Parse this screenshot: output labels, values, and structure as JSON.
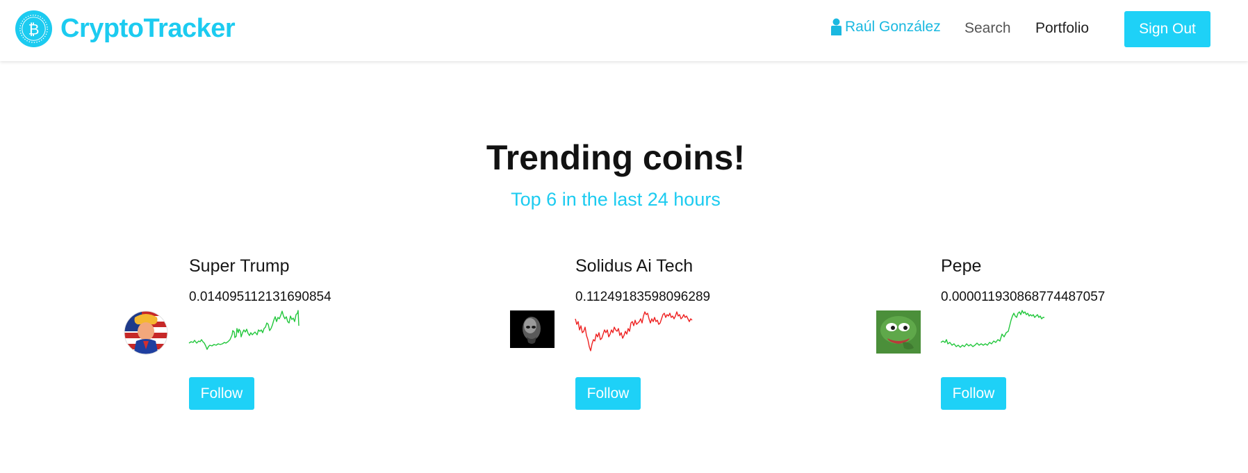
{
  "header": {
    "brand_name": "CryptoTracker",
    "user_name": "Raúl González",
    "search_label": "Search",
    "portfolio_label": "Portfolio",
    "signout_label": "Sign Out"
  },
  "hero": {
    "title": "Trending coins!",
    "subtitle": "Top 6 in the last 24 hours"
  },
  "coins": [
    {
      "name": "Super Trump",
      "price": "0.014095112131690854",
      "follow_label": "Follow",
      "trend": "up",
      "spark_color": "#22c73c"
    },
    {
      "name": "Solidus Ai Tech",
      "price": "0.11249183598096289",
      "follow_label": "Follow",
      "trend": "down",
      "spark_color": "#ee2222"
    },
    {
      "name": "Pepe",
      "price": "0.000011930868774487057",
      "follow_label": "Follow",
      "trend": "up",
      "spark_color": "#22c73c"
    }
  ],
  "colors": {
    "brand": "#1ccbf0",
    "button": "#1ed1f7",
    "user_link": "#1ab8e0"
  },
  "icons": {
    "logo": "bitcoin-logo-icon",
    "user": "user-icon"
  }
}
